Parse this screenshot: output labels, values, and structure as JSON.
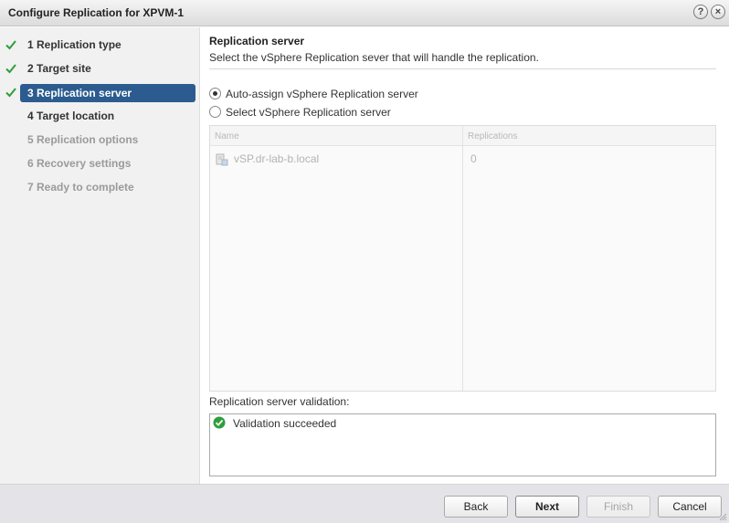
{
  "window": {
    "title": "Configure Replication for XPVM-1",
    "help_glyph": "?",
    "close_glyph": "×"
  },
  "steps": [
    {
      "label": "1  Replication type",
      "state": "done"
    },
    {
      "label": "2  Target site",
      "state": "done"
    },
    {
      "label": "3  Replication server",
      "state": "active"
    },
    {
      "label": "4  Target location",
      "state": "current"
    },
    {
      "label": "5  Replication options",
      "state": "disabled"
    },
    {
      "label": "6  Recovery settings",
      "state": "disabled"
    },
    {
      "label": "7  Ready to complete",
      "state": "disabled"
    }
  ],
  "content": {
    "heading": "Replication server",
    "description": "Select the vSphere Replication sever that will handle the replication.",
    "options": [
      {
        "label": "Auto-assign vSphere Replication server",
        "selected": true
      },
      {
        "label": "Select vSphere Replication server",
        "selected": false
      }
    ],
    "grid": {
      "columns": [
        "Name",
        "Replications"
      ],
      "rows": [
        {
          "name": "vSP.dr-lab-b.local",
          "replications": "0"
        }
      ]
    },
    "validation": {
      "label": "Replication server validation:",
      "message": "Validation succeeded"
    }
  },
  "footer": {
    "back_label": "Back",
    "next_label": "Next",
    "finish_label": "Finish",
    "cancel_label": "Cancel"
  },
  "colors": {
    "active_step": "#2c5c8f",
    "check_green": "#2e9e3a"
  }
}
